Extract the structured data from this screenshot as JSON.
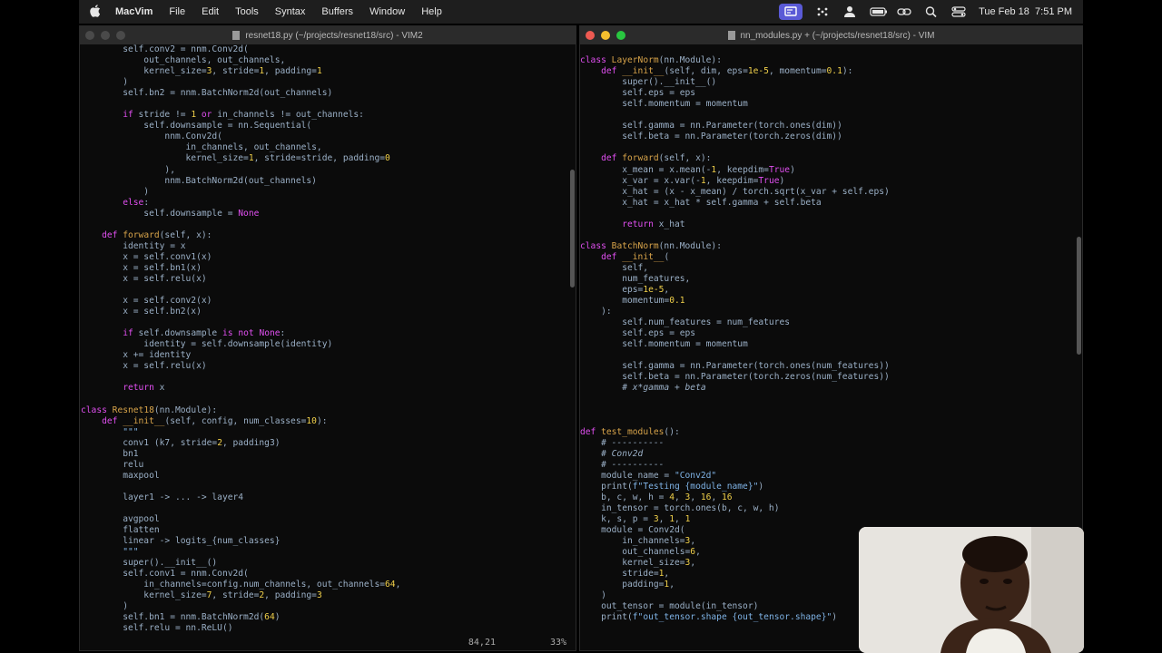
{
  "menubar": {
    "app": "MacVim",
    "menus": [
      "File",
      "Edit",
      "Tools",
      "Syntax",
      "Buffers",
      "Window",
      "Help"
    ],
    "clock": "Tue Feb 18  7:51 PM"
  },
  "left_window": {
    "title": "resnet18.py (~/projects/resnet18/src) - VIM2",
    "status_pos": "84,21",
    "status_pct": "33%"
  },
  "right_window": {
    "title": "nn_modules.py + (~/projects/resnet18/src) - VIM"
  },
  "left_code": [
    "        self.conv2 = nnm.Conv2d(",
    "            out_channels, out_channels,",
    "            kernel_size=3, stride=1, padding=1",
    "        )",
    "        self.bn2 = nnm.BatchNorm2d(out_channels)",
    "",
    "        if stride != 1 or in_channels != out_channels:",
    "            self.downsample = nn.Sequential(",
    "                nnm.Conv2d(",
    "                    in_channels, out_channels,",
    "                    kernel_size=1, stride=stride, padding=0",
    "                ),",
    "                nnm.BatchNorm2d(out_channels)",
    "            )",
    "        else:",
    "            self.downsample = None",
    "",
    "    def forward(self, x):",
    "        identity = x",
    "        x = self.conv1(x)",
    "        x = self.bn1(x)",
    "        x = self.relu(x)",
    "",
    "        x = self.conv2(x)",
    "        x = self.bn2(x)",
    "",
    "        if self.downsample is not None:",
    "            identity = self.downsample(identity)",
    "        x += identity",
    "        x = self.relu(x)",
    "",
    "        return x",
    "",
    "class Resnet18(nn.Module):",
    "    def __init__(self, config, num_classes=10):",
    "        \"\"\"",
    "        conv1 (k7, stride=2, padding3)",
    "        bn1",
    "        relu",
    "        maxpool",
    "",
    "        layer1 -> ... -> layer4",
    "",
    "        avgpool",
    "        flatten",
    "        linear -> logits_{num_classes}",
    "        \"\"\"",
    "        super().__init__()",
    "        self.conv1 = nnm.Conv2d(",
    "            in_channels=config.num_channels, out_channels=64,",
    "            kernel_size=7, stride=2, padding=3",
    "        )",
    "        self.bn1 = nnm.BatchNorm2d(64)",
    "        self.relu = nn.ReLU()"
  ],
  "right_code": [
    "",
    "class LayerNorm(nn.Module):",
    "    def __init__(self, dim, eps=1e-5, momentum=0.1):",
    "        super().__init__()",
    "        self.eps = eps",
    "        self.momentum = momentum",
    "",
    "        self.gamma = nn.Parameter(torch.ones(dim))",
    "        self.beta = nn.Parameter(torch.zeros(dim))",
    "",
    "    def forward(self, x):",
    "        x_mean = x.mean(-1, keepdim=True)",
    "        x_var = x.var(-1, keepdim=True)",
    "        x_hat = (x - x_mean) / torch.sqrt(x_var + self.eps)",
    "        x_hat = x_hat * self.gamma + self.beta",
    "",
    "        return x_hat",
    "",
    "class BatchNorm(nn.Module):",
    "    def __init__(",
    "        self,",
    "        num_features,",
    "        eps=1e-5,",
    "        momentum=0.1",
    "    ):",
    "        self.num_features = num_features",
    "        self.eps = eps",
    "        self.momentum = momentum",
    "",
    "        self.gamma = nn.Parameter(torch.ones(num_features))",
    "        self.beta = nn.Parameter(torch.zeros(num_features))",
    "        # x*gamma + beta",
    "",
    "",
    "",
    "def test_modules():",
    "    # ----------",
    "    # Conv2d",
    "    # ----------",
    "    module_name = \"Conv2d\"",
    "    print(f\"Testing {module_name}\")",
    "    b, c, w, h = 4, 3, 16, 16",
    "    in_tensor = torch.ones(b, c, w, h)",
    "    k, s, p = 3, 1, 1",
    "    module = Conv2d(",
    "        in_channels=3,",
    "        out_channels=6,",
    "        kernel_size=3,",
    "        stride=1,",
    "        padding=1,",
    "    )",
    "    out_tensor = module(in_tensor)",
    "    print(f\"out_tensor.shape {out_tensor.shape}\")"
  ],
  "icons": {
    "apple": "apple-logo-icon",
    "screen": "screen-share-icon",
    "status": [
      "screen-share-icon",
      "controller-icon",
      "user-icon",
      "battery-icon",
      "link-icon",
      "search-icon",
      "control-center-icon"
    ]
  }
}
